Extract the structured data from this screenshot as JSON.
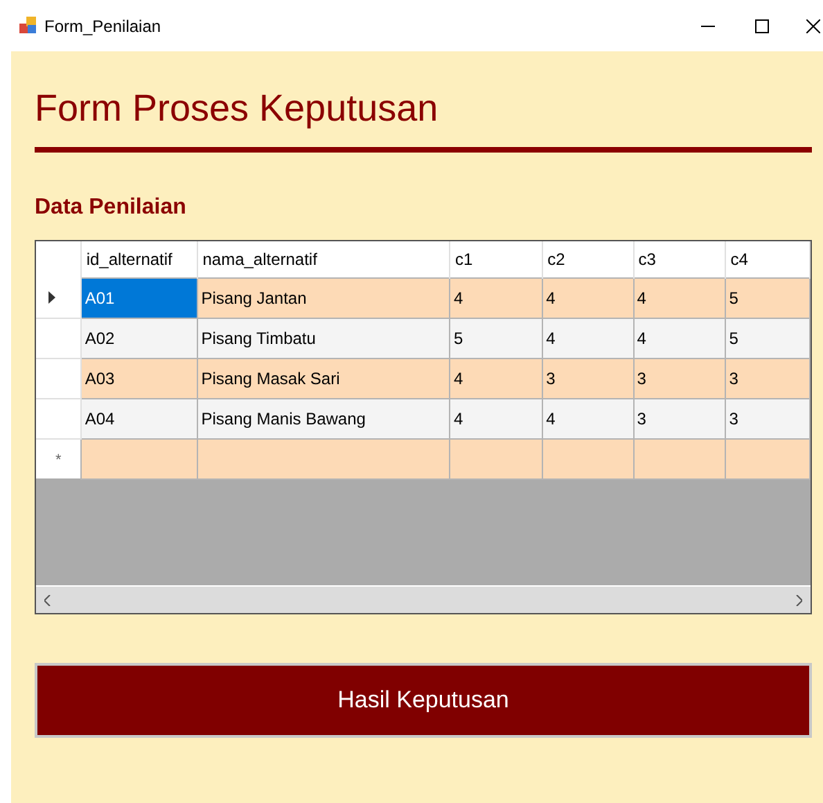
{
  "window": {
    "title": "Form_Penilaian"
  },
  "heading": "Form Proses Keputusan",
  "section_title": "Data Penilaian",
  "table": {
    "columns": [
      "id_alternatif",
      "nama_alternatif",
      "c1",
      "c2",
      "c3",
      "c4"
    ],
    "rows": [
      {
        "selected": true,
        "cells": [
          "A01",
          "Pisang Jantan",
          "4",
          "4",
          "4",
          "5"
        ]
      },
      {
        "selected": false,
        "cells": [
          "A02",
          "Pisang Timbatu",
          "5",
          "4",
          "4",
          "5"
        ]
      },
      {
        "selected": false,
        "cells": [
          "A03",
          "Pisang Masak Sari",
          "4",
          "3",
          "3",
          "3"
        ]
      },
      {
        "selected": false,
        "cells": [
          "A04",
          "Pisang Manis Bawang",
          "4",
          "4",
          "3",
          "3"
        ]
      }
    ],
    "new_row_marker": "*"
  },
  "button": "Hasil Keputusan"
}
